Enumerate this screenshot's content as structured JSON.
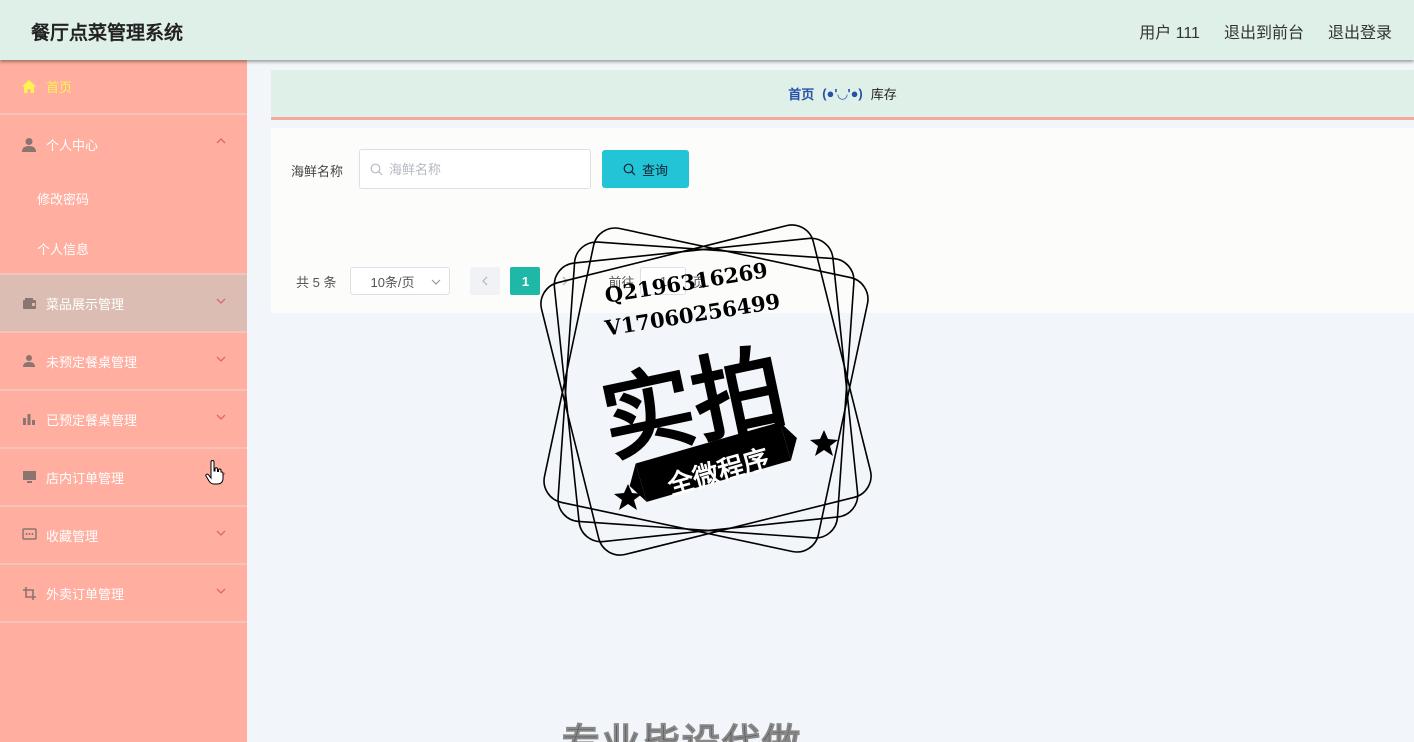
{
  "header": {
    "title": "餐厅点菜管理系统",
    "user": "用户 111",
    "to_front": "退出到前台",
    "logout": "退出登录"
  },
  "sidebar": {
    "home": "首页",
    "personal_center": "个人中心",
    "change_password": "修改密码",
    "personal_info": "个人信息",
    "items": [
      {
        "label": "菜品展示管理",
        "icon": "wallet-icon"
      },
      {
        "label": "未预定餐桌管理",
        "icon": "user-stamp-icon"
      },
      {
        "label": "已预定餐桌管理",
        "icon": "bar-chart-icon"
      },
      {
        "label": "店内订单管理",
        "icon": "monitor-icon"
      },
      {
        "label": "收藏管理",
        "icon": "chat-icon"
      },
      {
        "label": "外卖订单管理",
        "icon": "crop-icon"
      }
    ]
  },
  "breadcrumb": {
    "home": "首页",
    "face": "(●'◡'●)",
    "current": "库存"
  },
  "search": {
    "label": "海鲜名称",
    "placeholder": "海鲜名称",
    "value": "",
    "button": "查询"
  },
  "pagination": {
    "total": "共 5 条",
    "page_size": "10条/页",
    "current_page": "1",
    "goto_label": "前往",
    "goto_value": "1",
    "page_suffix": "页"
  },
  "watermark": {
    "line1": "Q2196316269",
    "line2": "V17060256499",
    "main": "实拍",
    "ribbon": "全微程序",
    "bottom": "专业毕设代做"
  },
  "colors": {
    "header_bg": "#dff0e8",
    "sidebar_bg": "#ffae9f",
    "home_active": "#fff44f",
    "query_button": "#23c4d6",
    "page_active": "#1fb7a6"
  }
}
